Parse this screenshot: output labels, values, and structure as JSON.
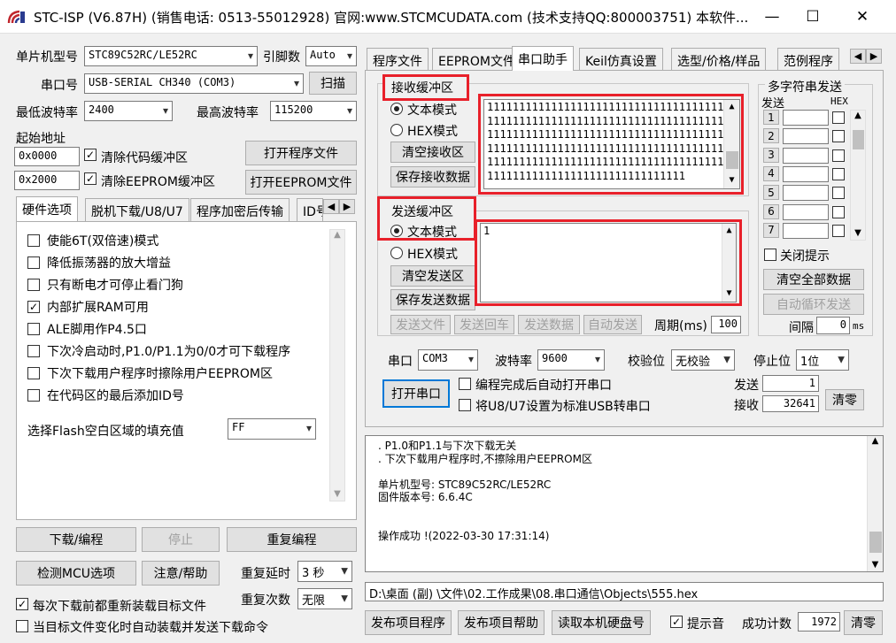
{
  "window": {
    "title": "STC-ISP (V6.87H) (销售电话: 0513-55012928) 官网:www.STCMCUDATA.com  (技术支持QQ:800003751) 本软件...",
    "minimize": "—",
    "maximize": "☐",
    "close": "✕"
  },
  "left": {
    "mcu_label": "单片机型号",
    "mcu_value": "STC89C52RC/LE52RC",
    "pins_label": "引脚数",
    "pins_value": "Auto",
    "port_label": "串口号",
    "port_value": "USB-SERIAL CH340 (COM3)",
    "scan_button": "扫描",
    "min_baud_label": "最低波特率",
    "min_baud_value": "2400",
    "max_baud_label": "最高波特率",
    "max_baud_value": "115200",
    "start_addr_label": "起始地址",
    "addr1": "0x0000",
    "clear_code_label": "清除代码缓冲区",
    "open_prog_button": "打开程序文件",
    "addr2": "0x2000",
    "clear_eeprom_label": "清除EEPROM缓冲区",
    "open_eeprom_button": "打开EEPROM文件",
    "tabs": [
      "硬件选项",
      "脱机下载/U8/U7",
      "程序加密后传输",
      "ID号"
    ],
    "options": [
      {
        "label": "使能6T(双倍速)模式",
        "checked": false
      },
      {
        "label": "降低振荡器的放大增益",
        "checked": false
      },
      {
        "label": "只有断电才可停止看门狗",
        "checked": false
      },
      {
        "label": "内部扩展RAM可用",
        "checked": true
      },
      {
        "label": "ALE脚用作P4.5口",
        "checked": false
      },
      {
        "label": "下次冷启动时,P1.0/P1.1为0/0才可下载程序",
        "checked": false
      },
      {
        "label": "下次下载用户程序时擦除用户EEPROM区",
        "checked": false
      },
      {
        "label": "在代码区的最后添加ID号",
        "checked": false
      }
    ],
    "fill_label": "选择Flash空白区域的填充值",
    "fill_value": "FF",
    "download_button": "下载/编程",
    "stop_button": "停止",
    "reprogram_button": "重复编程",
    "detect_button": "检测MCU选项",
    "help_button": "注意/帮助",
    "repeat_delay_label": "重复延时",
    "repeat_delay_value": "3 秒",
    "repeat_count_label": "重复次数",
    "repeat_count_value": "无限",
    "reload_label": "每次下载前都重新装载目标文件",
    "reload_checked": true,
    "autoload_label": "当目标文件变化时自动装载并发送下载命令",
    "autoload_checked": false
  },
  "right": {
    "tabs": [
      "程序文件",
      "EEPROM文件",
      "串口助手",
      "Keil仿真设置",
      "选型/价格/样品",
      "范例程序"
    ],
    "recv_group": "接收缓冲区",
    "recv_text_mode": "文本模式",
    "recv_hex_mode": "HEX模式",
    "clear_recv": "清空接收区",
    "save_recv": "保存接收数据",
    "recv_data": "111111111111111111111111111111111111111111111111111111111111111111111111111111111111111111111111111111111111111111111111111111111111111111111111111111111111111111111111111111111111111111111111111111111111111111111111",
    "send_group": "发送缓冲区",
    "send_text_mode": "文本模式",
    "send_hex_mode": "HEX模式",
    "clear_send": "清空发送区",
    "save_send": "保存发送数据",
    "send_data": "1",
    "send_file": "发送文件",
    "send_enter": "发送回车",
    "send_data_btn": "发送数据",
    "auto_send": "自动发送",
    "period_label": "周期(ms)",
    "period_value": "100",
    "multi_title": "多字符串发送",
    "send_col": "发送",
    "hex_col": "HEX",
    "multi_rows": [
      "1",
      "2",
      "3",
      "4",
      "5",
      "6",
      "7"
    ],
    "close_hint_label": "关闭提示",
    "clear_all": "清空全部数据",
    "auto_loop": "自动循环发送",
    "interval_label": "间隔",
    "interval_value": "0",
    "interval_unit": "ms",
    "com_label": "串口",
    "com_value": "COM3",
    "baud_label": "波特率",
    "baud_value": "9600",
    "parity_label": "校验位",
    "parity_value": "无校验",
    "stopbit_label": "停止位",
    "stopbit_value": "1位",
    "open_port": "打开串口",
    "auto_open_label": "编程完成后自动打开串口",
    "usb_label": "将U8/U7设置为标准USB转串口",
    "sent_label": "发送",
    "sent_value": "1",
    "recv_label": "接收",
    "recv_value": "32641",
    "zero_button": "清零",
    "log_lines": [
      ". P1.0和P1.1与下次下载无关",
      ". 下次下载用户程序时,不擦除用户EEPROM区",
      "",
      "单片机型号: STC89C52RC/LE52RC",
      "固件版本号: 6.6.4C",
      "",
      "",
      "操作成功 !(2022-03-30 17:31:14)"
    ],
    "path": "D:\\桌面 (副) \\文件\\02.工作成果\\08.串口通信\\Objects\\555.hex",
    "publish_prog": "发布项目程序",
    "publish_help": "发布项目帮助",
    "read_disk": "读取本机硬盘号",
    "sound_label": "提示音",
    "sound_checked": true,
    "success_label": "成功计数",
    "success_value": "1972",
    "zero2": "清零"
  }
}
